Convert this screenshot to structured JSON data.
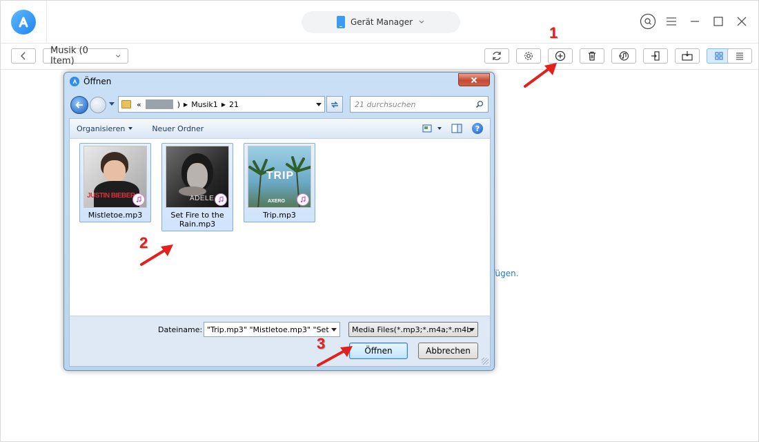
{
  "app": {
    "device_selector": "Gerät Manager",
    "category": "Musik (0 Item)",
    "hint_fragment": "ıfügen."
  },
  "dialog": {
    "title": "Öffnen",
    "address": {
      "prefix": "«",
      "paren": ")",
      "crumbs": [
        "Musik1",
        "21"
      ]
    },
    "search_placeholder": "21 durchsuchen",
    "commands": {
      "organize": "Organisieren",
      "new_folder": "Neuer Ordner"
    },
    "files": [
      {
        "name": "Mistletoe.mp3",
        "art_text": "JUSTIN BIEBER"
      },
      {
        "name": "Set Fire to the Rain.mp3",
        "art_text": "ADELE"
      },
      {
        "name": "Trip.mp3",
        "art_text": "TRIP",
        "art_sub": "AXERO"
      }
    ],
    "filename_label": "Dateiname:",
    "filename_value": "\"Trip.mp3\" \"Mistletoe.mp3\" \"Set",
    "filter_value": "Media Files(*.mp3;*.m4a;*.m4b",
    "open_label": "Öffnen",
    "cancel_label": "Abbrechen"
  },
  "annotations": {
    "step1": "1",
    "step2": "2",
    "step3": "3"
  },
  "colors": {
    "annotation": "#e2211c",
    "accent": "#2c8ef0",
    "hint": "#1e7bd8"
  }
}
